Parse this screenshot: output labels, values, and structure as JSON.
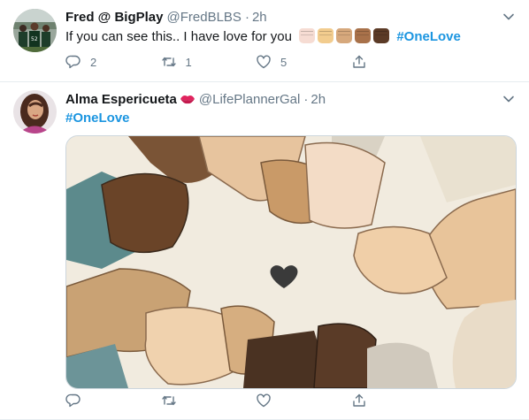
{
  "tweets": [
    {
      "display_name": "Fred @ BigPlay",
      "handle": "@FredBLBS",
      "dot": "·",
      "time": "2h",
      "text": "If you can see this.. I have love for you",
      "emoji_tones": [
        "#f6dcd3",
        "#f2cc8e",
        "#d6a87c",
        "#a8714a",
        "#5b3a26"
      ],
      "hashtag": "#OneLove",
      "replies": "2",
      "retweets": "1",
      "likes": "5"
    },
    {
      "display_name": "Alma Espericueta",
      "name_emoji": "kiss-lips-icon",
      "handle": "@LifePlannerGal",
      "dot": "·",
      "time": "2h",
      "hashtag": "#OneLove",
      "media": "illustration of hands of many skin tones clasped around a dark heart",
      "replies": "",
      "retweets": "",
      "likes": ""
    }
  ],
  "colors": {
    "link": "#1b95e0",
    "muted": "#657786",
    "divider": "#e6ecf0",
    "heart": "#3a3a3a",
    "illustration_bg": "#f1ebdf"
  }
}
